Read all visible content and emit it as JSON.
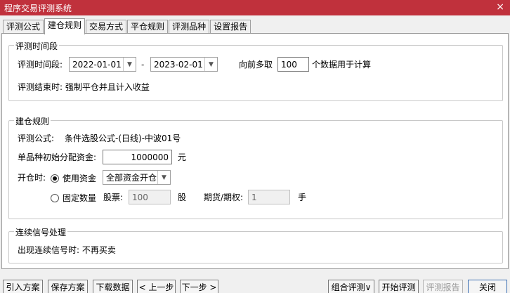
{
  "window": {
    "title": "程序交易评测系统",
    "close_label": "×"
  },
  "tabs": [
    "评测公式",
    "建仓规则",
    "交易方式",
    "平仓规则",
    "评测品种",
    "设置报告"
  ],
  "period": {
    "legend": "评测时间段",
    "label": "评测时间段:",
    "start_date": "2022-01-01",
    "separator": "-",
    "end_date": "2023-02-01",
    "lookback_prefix": "向前多取",
    "lookback_value": "100",
    "lookback_suffix": "个数据用于计算",
    "end_note": "评测结束时: 强制平仓并且计入收益"
  },
  "position": {
    "legend": "建仓规则",
    "formula_label": "评测公式:",
    "formula_value": "条件选股公式-(日线)-中波01号",
    "capital_label": "单品种初始分配资金:",
    "capital_value": "1000000",
    "capital_unit": "元",
    "open_label": "开仓时:",
    "use_capital_label": "使用资金",
    "use_capital_option": "全部资金开仓",
    "fixed_qty_label": "固定数量",
    "stock_label": "股票:",
    "stock_value": "100",
    "stock_unit": "股",
    "futures_label": "期货/期权:",
    "futures_value": "1",
    "futures_unit": "手"
  },
  "signal": {
    "legend": "连续信号处理",
    "text": "出现连续信号时: 不再买卖"
  },
  "buttons": {
    "import": "引入方案",
    "save": "保存方案",
    "download": "下载数据",
    "prev": "< 上一步",
    "next": "下一步 >",
    "combo": "组合评测∨",
    "start": "开始评测",
    "report": "评测报告",
    "close": "关闭"
  }
}
